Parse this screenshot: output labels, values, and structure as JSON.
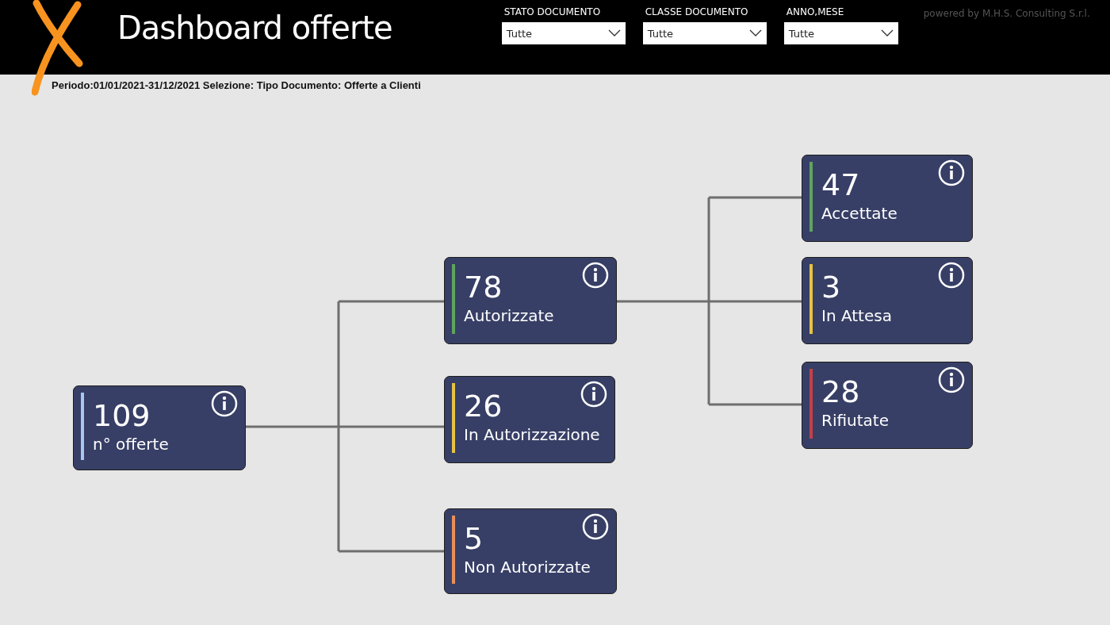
{
  "header": {
    "title": "Dashboard offerte",
    "powered_by": "powered by M.H.S. Consulting S.r.l."
  },
  "filters": [
    {
      "label": "STATO DOCUMENTO",
      "value": "Tutte"
    },
    {
      "label": "CLASSE DOCUMENTO",
      "value": "Tutte"
    },
    {
      "label": "ANNO,MESE",
      "value": "Tutte"
    }
  ],
  "period": "Periodo:01/01/2021-31/12/2021 Selezione: Tipo Documento: Offerte a Clienti",
  "nodes": [
    {
      "value": "109",
      "label": "n° offerte",
      "color": "#a6c8f0"
    },
    {
      "value": "78",
      "label": "Autorizzate",
      "color": "#5fa35f"
    },
    {
      "value": "26",
      "label": "In Autorizzazione",
      "color": "#e6c244"
    },
    {
      "value": "5",
      "label": "Non Autorizzate",
      "color": "#e88f5a"
    },
    {
      "value": "47",
      "label": "Accettate",
      "color": "#5fa35f"
    },
    {
      "value": "3",
      "label": "In Attesa",
      "color": "#e6c244"
    },
    {
      "value": "28",
      "label": "Rifiutate",
      "color": "#c2414b"
    }
  ]
}
